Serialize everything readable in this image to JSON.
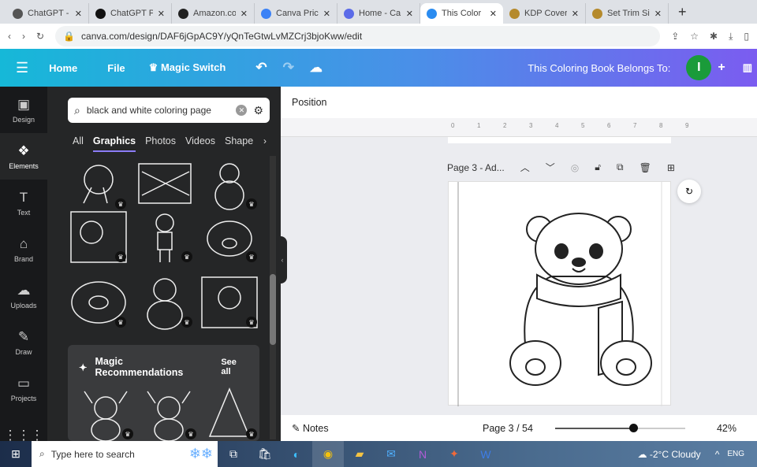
{
  "browser": {
    "tabs": [
      {
        "label": "ChatGPT -",
        "icon": "chatgpt-icon",
        "color": "#555"
      },
      {
        "label": "ChatGPT P",
        "icon": "chatgpt-icon",
        "color": "#111"
      },
      {
        "label": "Amazon.co",
        "icon": "amazon-icon",
        "color": "#222"
      },
      {
        "label": "Canva Pric",
        "icon": "canva-icon",
        "color": "#3b82f6"
      },
      {
        "label": "Home - Ca",
        "icon": "canva-icon",
        "color": "#5b6be8"
      },
      {
        "label": "This Color",
        "icon": "canva-icon",
        "color": "#2b8cf0",
        "active": true
      },
      {
        "label": "KDP Cover",
        "icon": "amazon-kdp-icon",
        "color": "#b58a2c"
      },
      {
        "label": "Set Trim Si",
        "icon": "amazon-kdp-icon",
        "color": "#b58a2c"
      }
    ],
    "url": "canva.com/design/DAF6jGpAC9Y/yQnTeGtwLvMZCrj3bjoKww/edit"
  },
  "topbar": {
    "home": "Home",
    "file": "File",
    "magic_switch": "Magic Switch",
    "title": "This Coloring Book Belongs To:",
    "avatar": "I",
    "avatar_color": "#1a9b3a"
  },
  "rail": [
    {
      "label": "Design",
      "icon": "design-icon"
    },
    {
      "label": "Elements",
      "icon": "elements-icon",
      "active": true
    },
    {
      "label": "Text",
      "icon": "text-icon"
    },
    {
      "label": "Brand",
      "icon": "brand-icon"
    },
    {
      "label": "Uploads",
      "icon": "uploads-icon"
    },
    {
      "label": "Draw",
      "icon": "draw-icon"
    },
    {
      "label": "Projects",
      "icon": "projects-icon"
    }
  ],
  "panel": {
    "search_value": "black and white coloring page",
    "categories": [
      "All",
      "Graphics",
      "Photos",
      "Videos",
      "Shape"
    ],
    "active_category": "Graphics",
    "magic_title": "Magic Recommendations",
    "see_all": "See all"
  },
  "canvas": {
    "position_label": "Position",
    "ruler": [
      "0",
      "1",
      "2",
      "3",
      "4",
      "5",
      "6",
      "7",
      "8",
      "9"
    ],
    "page_title": "Page 3 - Ad..."
  },
  "footer": {
    "notes": "Notes",
    "page": "Page 3 / 54",
    "zoom": "42%",
    "zoom_level": 42
  },
  "taskbar": {
    "search_placeholder": "Type here to search",
    "weather": "-2°C  Cloudy",
    "lang": "ENG"
  }
}
